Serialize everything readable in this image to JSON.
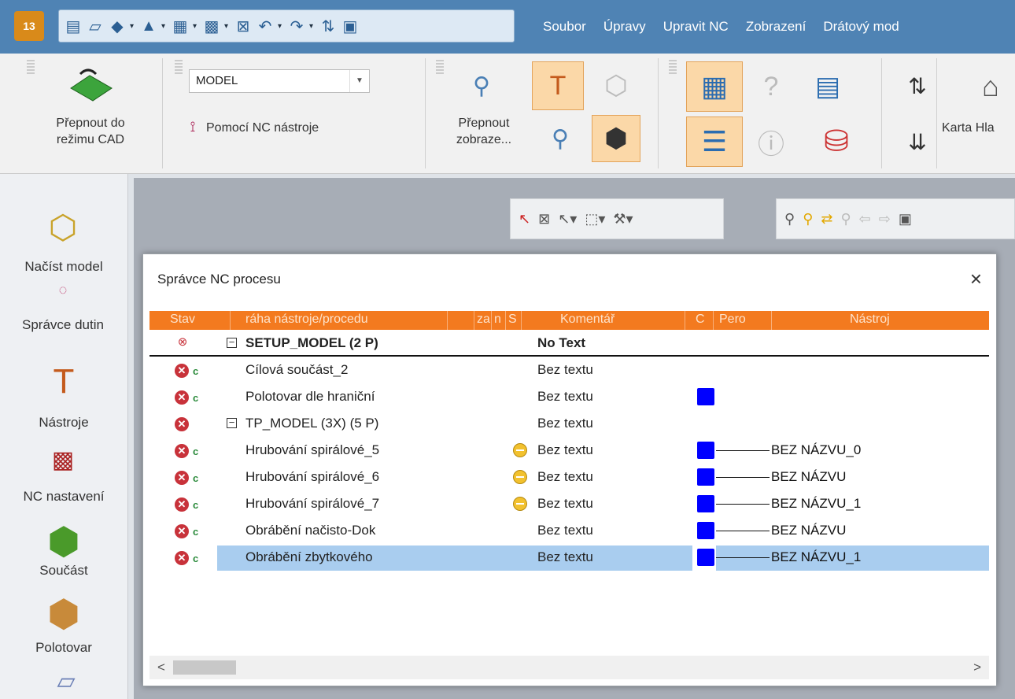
{
  "menu": [
    "Soubor",
    "Úpravy",
    "Upravit NC",
    "Zobrazení",
    "Drátový mod"
  ],
  "app_logo": "13",
  "ribbon": {
    "switch_cad": [
      "Přepnout do",
      "režimu CAD"
    ],
    "combo_value": "MODEL",
    "by_nc_tool": "Pomocí NC nástroje",
    "switch_view": [
      "Přepnout",
      "zobraze..."
    ],
    "karta": "Karta Hla"
  },
  "left_toolbar": {
    "items": [
      "Načíst model",
      "Správce dutin",
      "Nástroje",
      "NC nastavení",
      "Součást",
      "Polotovar"
    ]
  },
  "dialog": {
    "title": "Správce NC procesu",
    "close": "×",
    "columns": [
      "Stav",
      "ráha nástroje/procedu",
      "za",
      "n",
      "S",
      "Komentář",
      "C",
      "Pero",
      "Nástroj"
    ],
    "rows": [
      {
        "name": "SETUP_MODEL (2 P)",
        "comment": "No Text",
        "tool": "",
        "bold": true
      },
      {
        "name": "Cílová součást_2",
        "comment": "Bez textu",
        "tool": ""
      },
      {
        "name": "Polotovar dle hraniční",
        "comment": "Bez textu",
        "tool": ""
      },
      {
        "name": "TP_MODEL (3X) (5 P)",
        "comment": "Bez textu",
        "tool": ""
      },
      {
        "name": "Hrubování spirálové_5",
        "comment": "Bez textu",
        "tool": "BEZ NÁZVU_0"
      },
      {
        "name": "Hrubování spirálové_6",
        "comment": "Bez textu",
        "tool": "BEZ NÁZVU"
      },
      {
        "name": "Hrubování spirálové_7",
        "comment": "Bez textu",
        "tool": "BEZ NÁZVU_1"
      },
      {
        "name": "Obrábění načisto-Dok",
        "comment": "Bez textu",
        "tool": "BEZ NÁZVU"
      },
      {
        "name": "Obrábění zbytkového",
        "comment": "Bez textu",
        "tool": "BEZ NÁZVU_1"
      }
    ],
    "scroll_left": "<",
    "scroll_right": ">"
  },
  "colors": {
    "accent_header": "#f37a1f",
    "selection": "#a9cdef",
    "pen_blue": "#0000ff"
  }
}
